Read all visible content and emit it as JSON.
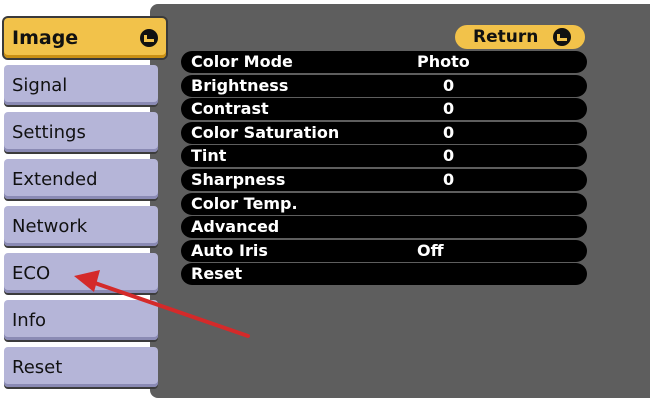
{
  "sidebar": {
    "items": [
      {
        "label": "Image",
        "active": true
      },
      {
        "label": "Signal"
      },
      {
        "label": "Settings"
      },
      {
        "label": "Extended"
      },
      {
        "label": "Network"
      },
      {
        "label": "ECO"
      },
      {
        "label": "Info"
      },
      {
        "label": "Reset"
      }
    ],
    "enter_icon": "enter-icon"
  },
  "main": {
    "return_label": "Return",
    "rows": [
      {
        "label": "Color Mode",
        "value": "Photo"
      },
      {
        "label": "Brightness",
        "value": "0"
      },
      {
        "label": "Contrast",
        "value": "0"
      },
      {
        "label": "Color Saturation",
        "value": "0"
      },
      {
        "label": "Tint",
        "value": "0"
      },
      {
        "label": "Sharpness",
        "value": "0"
      },
      {
        "label": "Color Temp.",
        "value": ""
      },
      {
        "label": "Advanced",
        "value": ""
      },
      {
        "label": "Auto Iris",
        "value": "Off"
      },
      {
        "label": "Reset",
        "value": ""
      }
    ]
  },
  "colors": {
    "active_tab": "#f2c24a",
    "inactive_tab": "#b5b5d8",
    "panel": "#5e5e5e",
    "row": "#000000",
    "annotation_arrow": "#d42a2a"
  }
}
